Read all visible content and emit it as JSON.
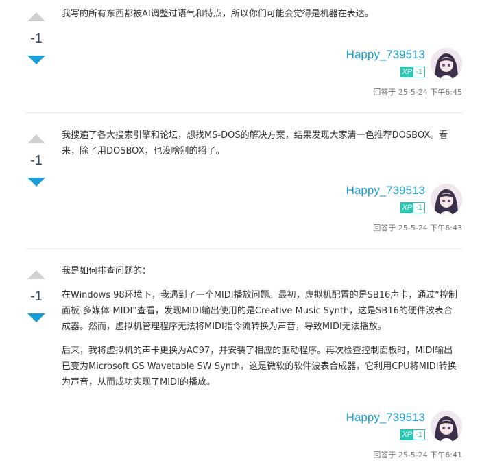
{
  "answers": [
    {
      "votes": "-1",
      "paragraphs": [
        "我写的所有东西都被AI调整过语气和特点，所以你们可能会觉得是机器在表达。"
      ],
      "author": "Happy_739513",
      "xp_label": "XP",
      "xp_value": "-1",
      "answered_at": "回答于 25-5-24 下午6:45"
    },
    {
      "votes": "-1",
      "paragraphs": [
        "我搜遍了各大搜索引擎和论坛，想找MS-DOS的解决方案，结果发现大家清一色推荐DOSBOX。看来，除了用DOSBOX，也没啥别的招了。"
      ],
      "author": "Happy_739513",
      "xp_label": "XP",
      "xp_value": "-1",
      "answered_at": "回答于 25-5-24 下午6:43"
    },
    {
      "votes": "-1",
      "paragraphs": [
        "我是如何排查问题的：",
        "在Windows 98环境下，我遇到了一个MIDI播放问题。最初，虚拟机配置的是SB16声卡，通过“控制面板-多媒体-MIDI”查看，发现MIDI输出使用的是Creative Music Synth，这是SB16的硬件波表合成器。然而，虚拟机管理程序无法将MIDI指令流转换为声音，导致MIDI无法播放。",
        "后来，我将虚拟机的声卡更换为AC97，并安装了相应的驱动程序。再次检查控制面板时，MIDI输出已变为Microsoft GS Wavetable SW Synth，这是微软的软件波表合成器，它利用CPU将MIDI转换为声音，从而成功实现了MIDI的播放。"
      ],
      "author": "Happy_739513",
      "xp_label": "XP",
      "xp_value": "-1",
      "answered_at": "回答于 25-5-24 下午6:41"
    }
  ],
  "colors": {
    "accent": "#1a9fd9",
    "xp": "#2bc4b0",
    "upvote": "#d0d0d0"
  }
}
